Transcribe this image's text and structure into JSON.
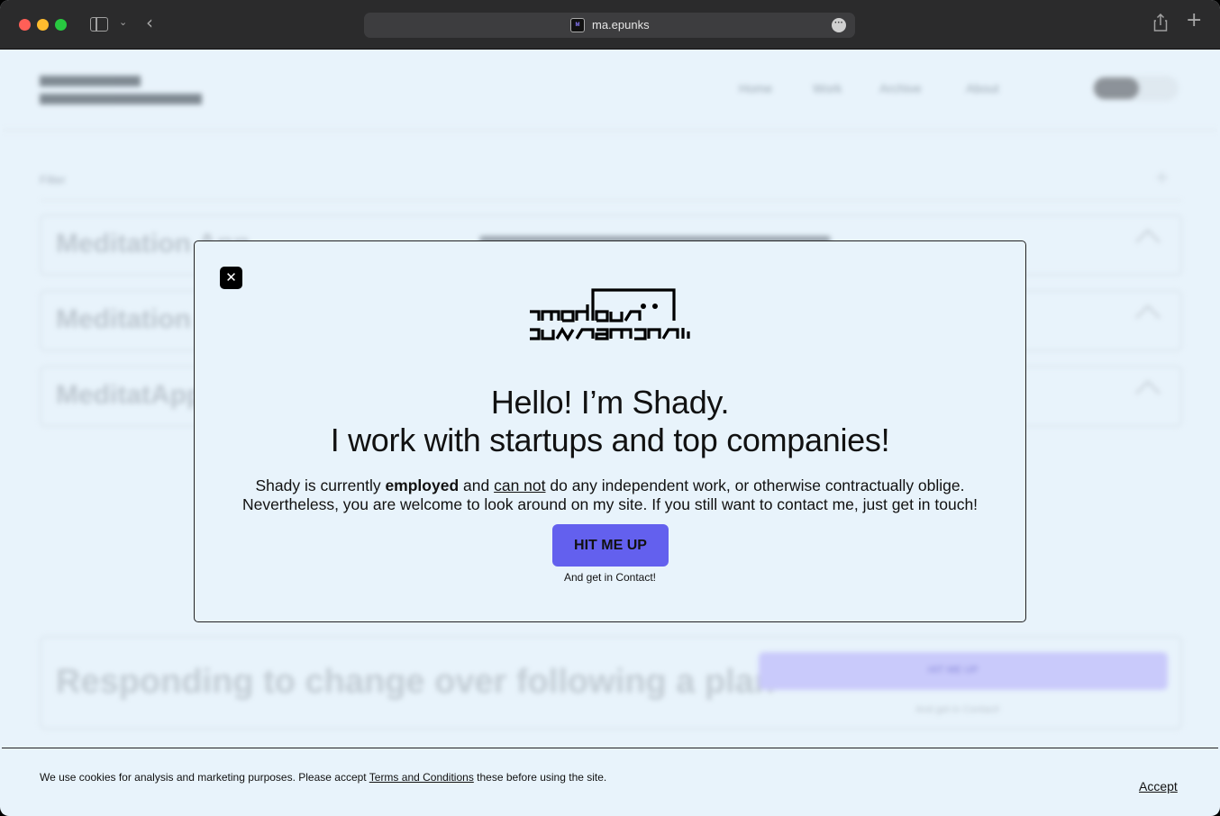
{
  "browser": {
    "url": "ma.epunks",
    "favicon_text": "M"
  },
  "background": {
    "nav": [
      "Home",
      "Work",
      "Archive",
      "About"
    ],
    "filter_label": "Filter",
    "rows": [
      "Meditation App",
      "Meditation App",
      "MeditatApp"
    ],
    "card_title": "Responding to change over following a plan",
    "card_button": "HIT ME UP",
    "card_sub": "And get in Contact!"
  },
  "modal": {
    "close_glyph": "✕",
    "heading_line1": "Hello! I’m Shady.",
    "heading_line2": "I work with startups and top companies!",
    "text_part1": "Shady is currently ",
    "text_bold": "employed",
    "text_part2": " and ",
    "text_underline": "can not",
    "text_part3": " do any independent work, or otherwise contractually oblige.",
    "text_line2": "Nevertheless, you are welcome to look around on my site. If you still want to contact me, just get in touch!",
    "button_label": "HIT ME UP",
    "button_sub": "And get in Contact!"
  },
  "cookie": {
    "text_before": "We use cookies for analysis and marketing purposes. Please accept ",
    "link": "Terms and Conditions",
    "text_after": " these before using the site.",
    "accept": "Accept"
  },
  "colors": {
    "accent": "#6360ee",
    "page_bg": "#e8f3fb",
    "titlebar": "#2b2b2c"
  }
}
